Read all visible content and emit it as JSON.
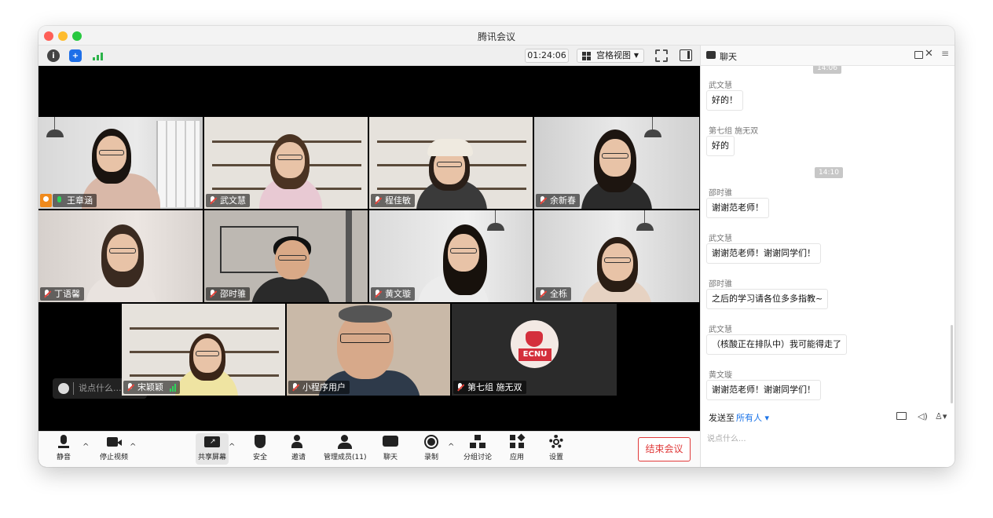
{
  "window": {
    "title": "腾讯会议"
  },
  "topbar": {
    "timer": "01:24:06",
    "view_label": "宫格视图"
  },
  "participants": [
    {
      "name": "王章涵"
    },
    {
      "name": "武文慧"
    },
    {
      "name": "程佳敏"
    },
    {
      "name": "余新春"
    },
    {
      "name": "丁语馨"
    },
    {
      "name": "邵时骓"
    },
    {
      "name": "黄文璇"
    },
    {
      "name": "全栎"
    },
    {
      "name": "宋颖颖"
    },
    {
      "name": "小程序用户"
    },
    {
      "name": "第七组 施无双",
      "avatar_text": "ECNU"
    }
  ],
  "float_input": {
    "placeholder": "说点什么..."
  },
  "toolbar": {
    "mute": "静音",
    "stop_video": "停止视频",
    "share_screen": "共享屏幕",
    "security": "安全",
    "invite": "邀请",
    "manage_members": "管理成员(11)",
    "chat": "聊天",
    "record": "录制",
    "breakout": "分组讨论",
    "apps": "应用",
    "settings": "设置",
    "end_meeting": "结束会议"
  },
  "chat": {
    "title": "聊天",
    "top_time": "14:06",
    "messages": [
      {
        "sender": "武文慧",
        "text": "好的！"
      },
      {
        "sender": "第七组 施无双",
        "text": "好的"
      },
      {
        "sender": "邵时骓",
        "text": "谢谢范老师！"
      },
      {
        "sender": "武文慧",
        "text": "谢谢范老师！谢谢同学们！"
      },
      {
        "sender": "邵时骓",
        "text": "之后的学习请各位多多指教~"
      },
      {
        "sender": "武文慧",
        "text": "（核酸正在排队中）我可能得走了"
      },
      {
        "sender": "黄文璇",
        "text": "谢谢范老师！谢谢同学们！"
      }
    ],
    "time_divider": "14:10",
    "send_to_label": "发送至",
    "send_to_target": "所有人",
    "input_placeholder": "说点什么..."
  },
  "colors": {
    "active_speaker": "#2fb352",
    "end_button": "#e03a3a",
    "link": "#1a73e8"
  }
}
